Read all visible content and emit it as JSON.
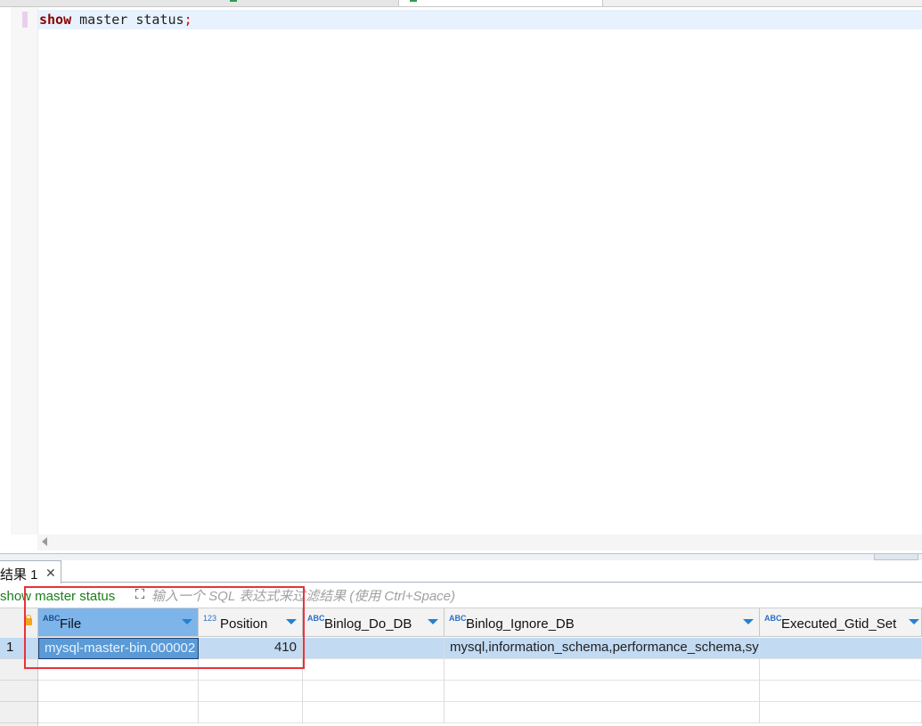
{
  "editor": {
    "code_keyword": "show",
    "code_rest": " master status",
    "code_terminator": ";"
  },
  "results": {
    "tab_label": "结果 1",
    "tab_close": "✕"
  },
  "filter": {
    "query_text": "show master status",
    "placeholder": "输入一个 SQL 表达式来过滤结果 (使用 Ctrl+Space)"
  },
  "grid": {
    "columns": [
      {
        "type": "ABC",
        "name": "File"
      },
      {
        "type": "123",
        "name": "Position"
      },
      {
        "type": "ABC",
        "name": "Binlog_Do_DB"
      },
      {
        "type": "ABC",
        "name": "Binlog_Ignore_DB"
      },
      {
        "type": "ABC",
        "name": "Executed_Gtid_Set"
      }
    ],
    "rows": [
      {
        "num": "1",
        "File": "mysql-master-bin.000002",
        "Position": "410",
        "Binlog_Do_DB": "",
        "Binlog_Ignore_DB": "mysql,information_schema,performance_schema,sys",
        "Executed_Gtid_Set": ""
      }
    ]
  },
  "colors": {
    "selected_header": "#7db4ea",
    "selected_row": "#c2daf2",
    "focused_cell": "#5a9ad6",
    "annotation_box": "#e8333b",
    "keyword": "#8b0000",
    "filter_query": "#1a7f1a"
  }
}
